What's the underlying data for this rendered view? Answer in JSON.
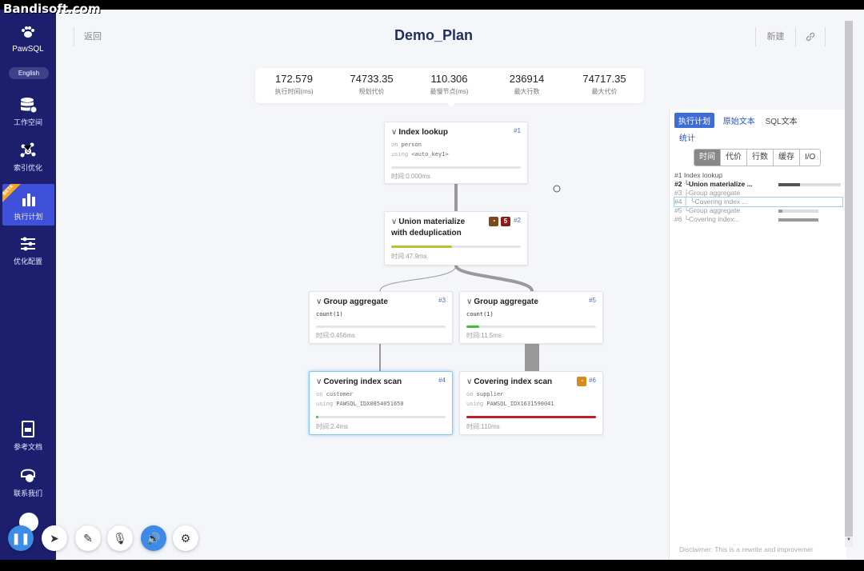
{
  "watermark": "Bandisoft.com",
  "sidebar": {
    "brand": "PawSQL",
    "lang": "English",
    "items": [
      {
        "label": "工作空间",
        "icon": "database-stack-icon"
      },
      {
        "label": "索引优化",
        "icon": "index-tuning-icon"
      },
      {
        "label": "执行计划",
        "icon": "bar-chart-icon",
        "tag": "BETA"
      },
      {
        "label": "优化配置",
        "icon": "sliders-icon"
      }
    ],
    "bottom_items": [
      {
        "label": "参考文档",
        "icon": "document-icon"
      },
      {
        "label": "联系我们",
        "icon": "contact-icon"
      }
    ]
  },
  "header": {
    "back": "返回",
    "title": "Demo_Plan",
    "new": "新建",
    "link_icon": "link-icon"
  },
  "stats": [
    {
      "value": "172.579",
      "label": "执行时间(ms)"
    },
    {
      "value": "74733.35",
      "label": "规划代价"
    },
    {
      "value": "110.306",
      "label": "最慢节点(ms)"
    },
    {
      "value": "236914",
      "label": "最大行数"
    },
    {
      "value": "74717.35",
      "label": "最大代价"
    }
  ],
  "nodes": {
    "n1": {
      "title": "Index lookup",
      "num": "#1",
      "on": "on",
      "table": "person",
      "using": "using",
      "index": "<auto_key1>",
      "time": "时间:0.000ms",
      "progress": 0.0
    },
    "n2": {
      "title1": "Union materialize",
      "title2": "with deduplication",
      "num": "#2",
      "badge": "5",
      "time": "时间:47.9ms",
      "progress": 0.47,
      "color": "#b8c22a"
    },
    "n3": {
      "title": "Group aggregate",
      "num": "#3",
      "detail": "count(1)",
      "time": "时间:0.456ms",
      "progress": 0.0
    },
    "n5": {
      "title": "Group aggregate",
      "num": "#5",
      "detail": "count(1)",
      "time": "时间:11.5ms",
      "progress": 0.1,
      "color": "#3dbd3d"
    },
    "n4": {
      "title": "Covering index scan",
      "num": "#4",
      "on": "on",
      "table": "customer",
      "using": "using",
      "index": "PAWSQL_IDX0854051650",
      "time": "时间:2.4ms",
      "progress": 0.02,
      "color": "#3dbd3d"
    },
    "n6": {
      "title": "Covering index scan",
      "num": "#6",
      "on": "on",
      "table": "supplier",
      "using": "using",
      "index": "PAWSQL_IDX1631590041",
      "time": "时间:110ms",
      "progress": 1.0,
      "color": "#c0202a"
    }
  },
  "right_panel": {
    "tabs": [
      "执行计划",
      "原始文本",
      "SQL文本"
    ],
    "tab2": "统计",
    "metric_tabs": [
      "时间",
      "代价",
      "行数",
      "缓存",
      "I/O"
    ],
    "tree": [
      {
        "text": "#1 Index lookup",
        "progress": 0.0
      },
      {
        "text": "#2 └Union materialize ...",
        "progress": 0.35
      },
      {
        "text": "#3    ├Group aggregate",
        "progress": 0.0
      },
      {
        "text": "#4    │ └Covering index ...",
        "progress": 0.02
      },
      {
        "text": "#5    └Group aggregate",
        "progress": 0.1
      },
      {
        "text": "#6       └Covering index...",
        "progress": 1.0
      }
    ],
    "disclaimer": "Disclaimer: This is a rewrite and improvemer"
  },
  "toolbar": [
    {
      "icon": "pause-icon"
    },
    {
      "icon": "cursor-icon"
    },
    {
      "icon": "pen-icon"
    },
    {
      "icon": "mic-off-icon"
    },
    {
      "icon": "speaker-icon"
    },
    {
      "icon": "settings-icon"
    }
  ],
  "colors": {
    "sidebar": "#1c1f6e",
    "accent": "#3f6dd8",
    "active_item": "#3f51d8"
  }
}
